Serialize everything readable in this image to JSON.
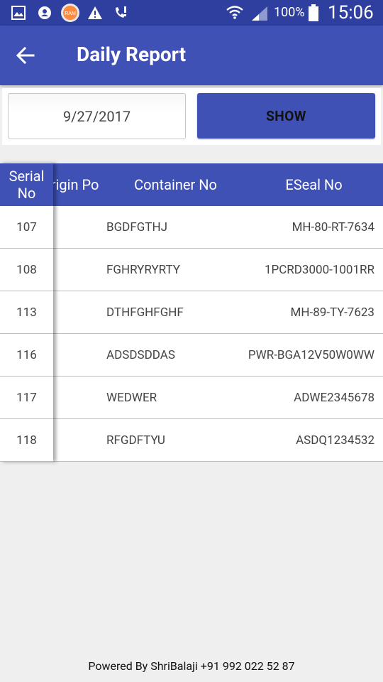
{
  "status_bar": {
    "battery": "100%",
    "time": "15:06",
    "icons": [
      "gallery-icon",
      "account-icon",
      "ram-booster-icon",
      "warning-icon",
      "phone-alert-icon",
      "wifi-icon",
      "signal-icon",
      "battery-icon"
    ],
    "ram_badge": "RAM"
  },
  "app_bar": {
    "title": "Daily Report",
    "back_icon": "arrow-left-icon"
  },
  "filter": {
    "date_value": "9/27/2017",
    "show_label": "SHOW"
  },
  "table": {
    "headers": {
      "serial_line1": "Serial",
      "serial_line2": "No",
      "origin_port": "Origin Port",
      "container_no": "Container No",
      "eseal_no": "ESeal No"
    },
    "rows": [
      {
        "serial": "107",
        "container": "BGDFGTHJ",
        "eseal": "MH-80-RT-7634"
      },
      {
        "serial": "108",
        "container": "FGHRYRYRTY",
        "eseal": "1PCRD3000-1001RR"
      },
      {
        "serial": "113",
        "container": "DTHFGHFGHF",
        "eseal": "MH-89-TY-7623"
      },
      {
        "serial": "116",
        "container": "ADSDSDDAS",
        "eseal": "PWR-BGA12V50W0WW"
      },
      {
        "serial": "117",
        "container": "WEDWER",
        "eseal": "ADWE2345678"
      },
      {
        "serial": "118",
        "container": "RFGDFTYU",
        "eseal": "ASDQ1234532"
      }
    ]
  },
  "footer": {
    "text": "Powered By ShriBalaji +91 992 022 52 87"
  },
  "colors": {
    "status_bar": "#2f3f9f",
    "primary": "#3f51b5",
    "background": "#efefef"
  }
}
